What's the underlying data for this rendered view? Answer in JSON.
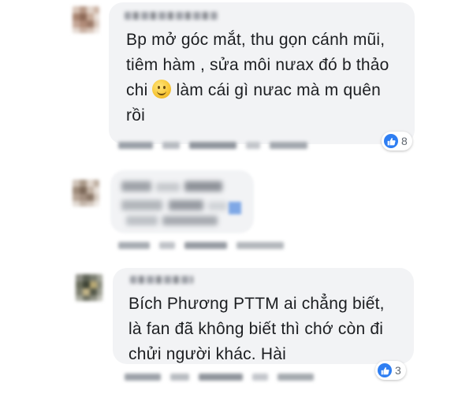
{
  "comments": [
    {
      "lines": [
        "Bp mở góc mắt, thu gọn cánh mũi,",
        "tiêm hàm , sửa môi nưax đó b thảo"
      ],
      "line3_before_emoji": "chi",
      "line3_after_emoji": "làm cái gì nưac mà m quên",
      "line4": "rồi",
      "emoji": "slightly-smiling-face-icon",
      "reaction_count": "8"
    },
    {
      "lines": [],
      "reaction_count": ""
    },
    {
      "lines": [
        "Bích Phương PTTM ai chẳng biết,",
        "là fan đã không biết thì chớ còn đi",
        "chửi người khác. Hài"
      ],
      "reaction_count": "3"
    }
  ],
  "colors": {
    "bubble": "#f2f3f5",
    "like": "#2e7ef2",
    "text": "#1c1e21"
  }
}
